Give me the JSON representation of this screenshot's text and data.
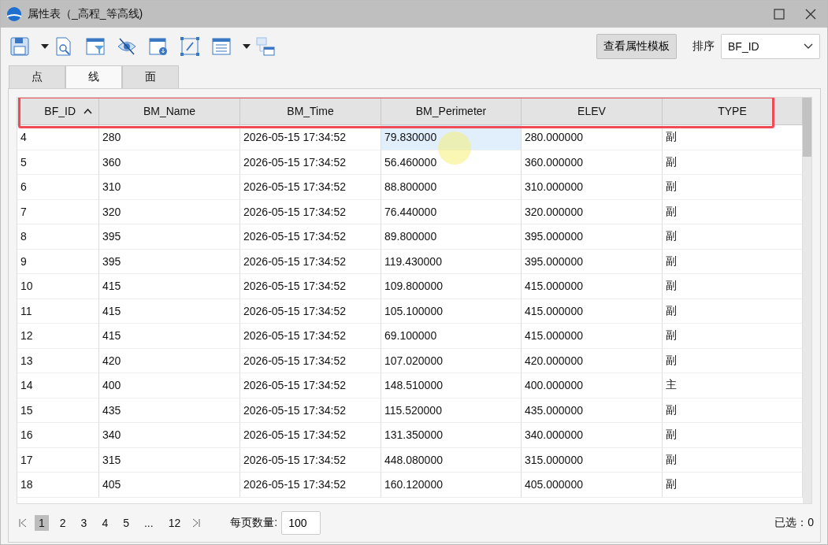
{
  "window": {
    "title": "属性表（_高程_等高线)"
  },
  "toolbar": {
    "template_button": "查看属性模板",
    "sort_label": "排序",
    "sort_value": "BF_ID"
  },
  "tabs": [
    {
      "label": "点",
      "selected": false
    },
    {
      "label": "线",
      "selected": true
    },
    {
      "label": "面",
      "selected": false
    }
  ],
  "table": {
    "columns": [
      {
        "label": "BF_ID",
        "sorted": true
      },
      {
        "label": "BM_Name",
        "sorted": false
      },
      {
        "label": "BM_Time",
        "sorted": false
      },
      {
        "label": "BM_Perimeter",
        "sorted": false
      },
      {
        "label": "ELEV",
        "sorted": false
      },
      {
        "label": "TYPE",
        "sorted": false
      }
    ],
    "rows": [
      [
        {
          "text": "4",
          "selected": false
        },
        {
          "text": "280",
          "selected": false
        },
        {
          "text": "2026-05-15 17:34:52",
          "selected": false
        },
        {
          "text": "79.830000",
          "selected": true
        },
        {
          "text": "280.000000",
          "selected": false
        },
        {
          "text": "副",
          "selected": false
        }
      ],
      [
        {
          "text": "5",
          "selected": false
        },
        {
          "text": "360",
          "selected": false
        },
        {
          "text": "2026-05-15 17:34:52",
          "selected": false
        },
        {
          "text": "56.460000",
          "selected": false
        },
        {
          "text": "360.000000",
          "selected": false
        },
        {
          "text": "副",
          "selected": false
        }
      ],
      [
        {
          "text": "6",
          "selected": false
        },
        {
          "text": "310",
          "selected": false
        },
        {
          "text": "2026-05-15 17:34:52",
          "selected": false
        },
        {
          "text": "88.800000",
          "selected": false
        },
        {
          "text": "310.000000",
          "selected": false
        },
        {
          "text": "副",
          "selected": false
        }
      ],
      [
        {
          "text": "7",
          "selected": false
        },
        {
          "text": "320",
          "selected": false
        },
        {
          "text": "2026-05-15 17:34:52",
          "selected": false
        },
        {
          "text": "76.440000",
          "selected": false
        },
        {
          "text": "320.000000",
          "selected": false
        },
        {
          "text": "副",
          "selected": false
        }
      ],
      [
        {
          "text": "8",
          "selected": false
        },
        {
          "text": "395",
          "selected": false
        },
        {
          "text": "2026-05-15 17:34:52",
          "selected": false
        },
        {
          "text": "89.800000",
          "selected": false
        },
        {
          "text": "395.000000",
          "selected": false
        },
        {
          "text": "副",
          "selected": false
        }
      ],
      [
        {
          "text": "9",
          "selected": false
        },
        {
          "text": "395",
          "selected": false
        },
        {
          "text": "2026-05-15 17:34:52",
          "selected": false
        },
        {
          "text": "119.430000",
          "selected": false
        },
        {
          "text": "395.000000",
          "selected": false
        },
        {
          "text": "副",
          "selected": false
        }
      ],
      [
        {
          "text": "10",
          "selected": false
        },
        {
          "text": "415",
          "selected": false
        },
        {
          "text": "2026-05-15 17:34:52",
          "selected": false
        },
        {
          "text": "109.800000",
          "selected": false
        },
        {
          "text": "415.000000",
          "selected": false
        },
        {
          "text": "副",
          "selected": false
        }
      ],
      [
        {
          "text": "11",
          "selected": false
        },
        {
          "text": "415",
          "selected": false
        },
        {
          "text": "2026-05-15 17:34:52",
          "selected": false
        },
        {
          "text": "105.100000",
          "selected": false
        },
        {
          "text": "415.000000",
          "selected": false
        },
        {
          "text": "副",
          "selected": false
        }
      ],
      [
        {
          "text": "12",
          "selected": false
        },
        {
          "text": "415",
          "selected": false
        },
        {
          "text": "2026-05-15 17:34:52",
          "selected": false
        },
        {
          "text": "69.100000",
          "selected": false
        },
        {
          "text": "415.000000",
          "selected": false
        },
        {
          "text": "副",
          "selected": false
        }
      ],
      [
        {
          "text": "13",
          "selected": false
        },
        {
          "text": "420",
          "selected": false
        },
        {
          "text": "2026-05-15 17:34:52",
          "selected": false
        },
        {
          "text": "107.020000",
          "selected": false
        },
        {
          "text": "420.000000",
          "selected": false
        },
        {
          "text": "副",
          "selected": false
        }
      ],
      [
        {
          "text": "14",
          "selected": false
        },
        {
          "text": "400",
          "selected": false
        },
        {
          "text": "2026-05-15 17:34:52",
          "selected": false
        },
        {
          "text": "148.510000",
          "selected": false
        },
        {
          "text": "400.000000",
          "selected": false
        },
        {
          "text": "主",
          "selected": false
        }
      ],
      [
        {
          "text": "15",
          "selected": false
        },
        {
          "text": "435",
          "selected": false
        },
        {
          "text": "2026-05-15 17:34:52",
          "selected": false
        },
        {
          "text": "115.520000",
          "selected": false
        },
        {
          "text": "435.000000",
          "selected": false
        },
        {
          "text": "副",
          "selected": false
        }
      ],
      [
        {
          "text": "16",
          "selected": false
        },
        {
          "text": "340",
          "selected": false
        },
        {
          "text": "2026-05-15 17:34:52",
          "selected": false
        },
        {
          "text": "131.350000",
          "selected": false
        },
        {
          "text": "340.000000",
          "selected": false
        },
        {
          "text": "副",
          "selected": false
        }
      ],
      [
        {
          "text": "17",
          "selected": false
        },
        {
          "text": "315",
          "selected": false
        },
        {
          "text": "2026-05-15 17:34:52",
          "selected": false
        },
        {
          "text": "448.080000",
          "selected": false
        },
        {
          "text": "315.000000",
          "selected": false
        },
        {
          "text": "副",
          "selected": false
        }
      ],
      [
        {
          "text": "18",
          "selected": false
        },
        {
          "text": "405",
          "selected": false
        },
        {
          "text": "2026-05-15 17:34:52",
          "selected": false
        },
        {
          "text": "160.120000",
          "selected": false
        },
        {
          "text": "405.000000",
          "selected": false
        },
        {
          "text": "副",
          "selected": false
        }
      ]
    ]
  },
  "pager": {
    "pages": [
      {
        "label": "1",
        "selected": true
      },
      {
        "label": "2",
        "selected": false
      },
      {
        "label": "3",
        "selected": false
      },
      {
        "label": "4",
        "selected": false
      },
      {
        "label": "5",
        "selected": false
      },
      {
        "label": "...",
        "selected": false
      },
      {
        "label": "12",
        "selected": false
      }
    ],
    "page_size_label": "每页数量:",
    "page_size": "100",
    "selection_status": "已选：0"
  }
}
